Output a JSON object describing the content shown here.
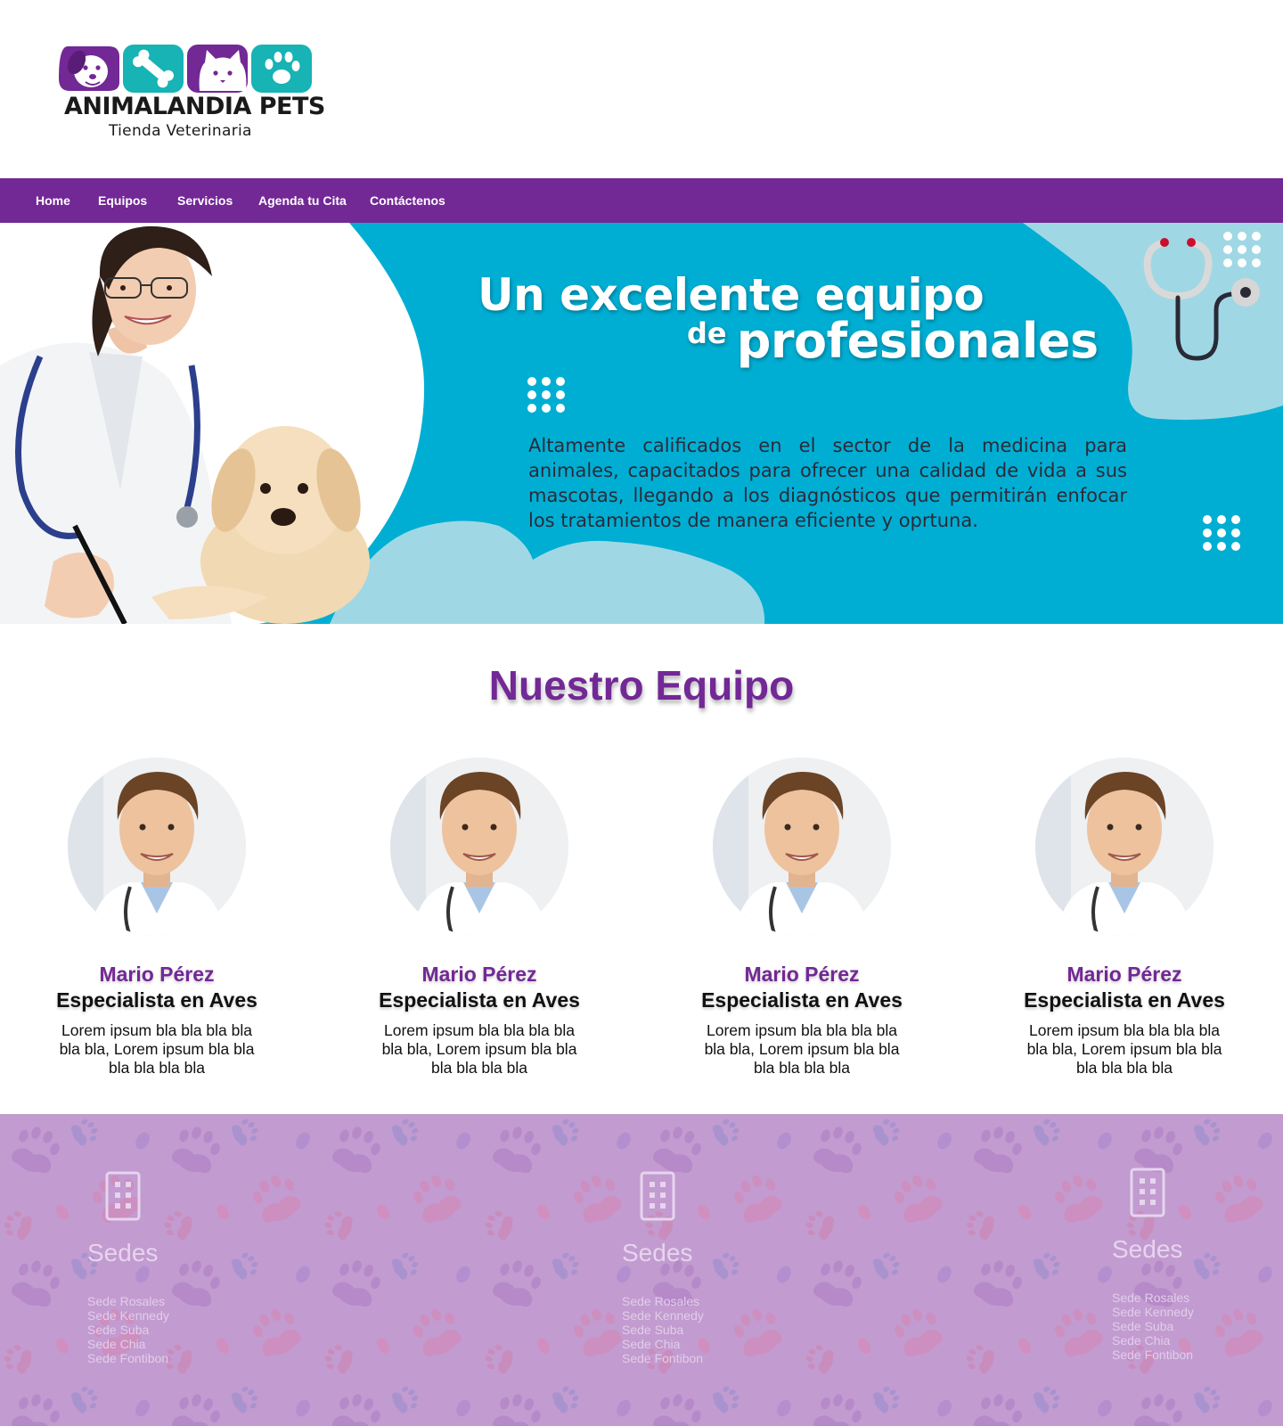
{
  "brand": {
    "name": "ANIMALANDIA PETS",
    "tagline": "Tienda Veterinaria",
    "colors": {
      "purple": "#722895",
      "teal": "#17b3b5",
      "hero_blue": "#00aed3",
      "light_blue": "#9fd8e4",
      "lilac": "#c29bd0"
    }
  },
  "nav": {
    "items": [
      {
        "label": "Home"
      },
      {
        "label": "Equipos"
      },
      {
        "label": "Servicios"
      },
      {
        "label": "Agenda tu Cita"
      },
      {
        "label": "Contáctenos"
      }
    ]
  },
  "hero": {
    "title_line1": "Un excelente equipo",
    "title_de": "de",
    "title_line2": "profesionales",
    "text": "Altamente calificados en el sector de la medicina para animales, capacitados para ofrecer una calidad de vida a sus mascotas, llegando a los diagnósticos que permitirán enfocar los tratamientos de manera eficiente y oprtuna."
  },
  "team": {
    "title": "Nuestro Equipo",
    "members": [
      {
        "name": "Mario Pérez",
        "role": "Especialista en Aves",
        "desc": "Lorem ipsum bla bla bla bla bla bla, Lorem ipsum bla bla bla bla bla bla"
      },
      {
        "name": "Mario Pérez",
        "role": "Especialista en Aves",
        "desc": "Lorem ipsum bla bla bla bla bla bla, Lorem ipsum bla bla bla bla bla bla"
      },
      {
        "name": "Mario Pérez",
        "role": "Especialista en Aves",
        "desc": "Lorem ipsum bla bla bla bla bla bla, Lorem ipsum bla bla bla bla bla bla"
      },
      {
        "name": "Mario Pérez",
        "role": "Especialista en Aves",
        "desc": "Lorem ipsum bla bla bla bla bla bla, Lorem ipsum bla bla bla bla bla bla"
      }
    ]
  },
  "sedes": {
    "columns": [
      {
        "title": "Sedes",
        "icon": "building-icon",
        "items": [
          "Sede Rosales",
          "Sede Kennedy",
          "Sede Suba",
          "Sede Chia",
          "Sede Fontibon"
        ]
      },
      {
        "title": "Sedes",
        "icon": "building-icon",
        "items": [
          "Sede Rosales",
          "Sede Kennedy",
          "Sede Suba",
          "Sede Chia",
          "Sede Fontibon"
        ]
      },
      {
        "title": "Sedes",
        "icon": "building-icon",
        "items": [
          "Sede Rosales",
          "Sede Kennedy",
          "Sede Suba",
          "Sede Chia",
          "Sede Fontibon"
        ]
      }
    ]
  }
}
